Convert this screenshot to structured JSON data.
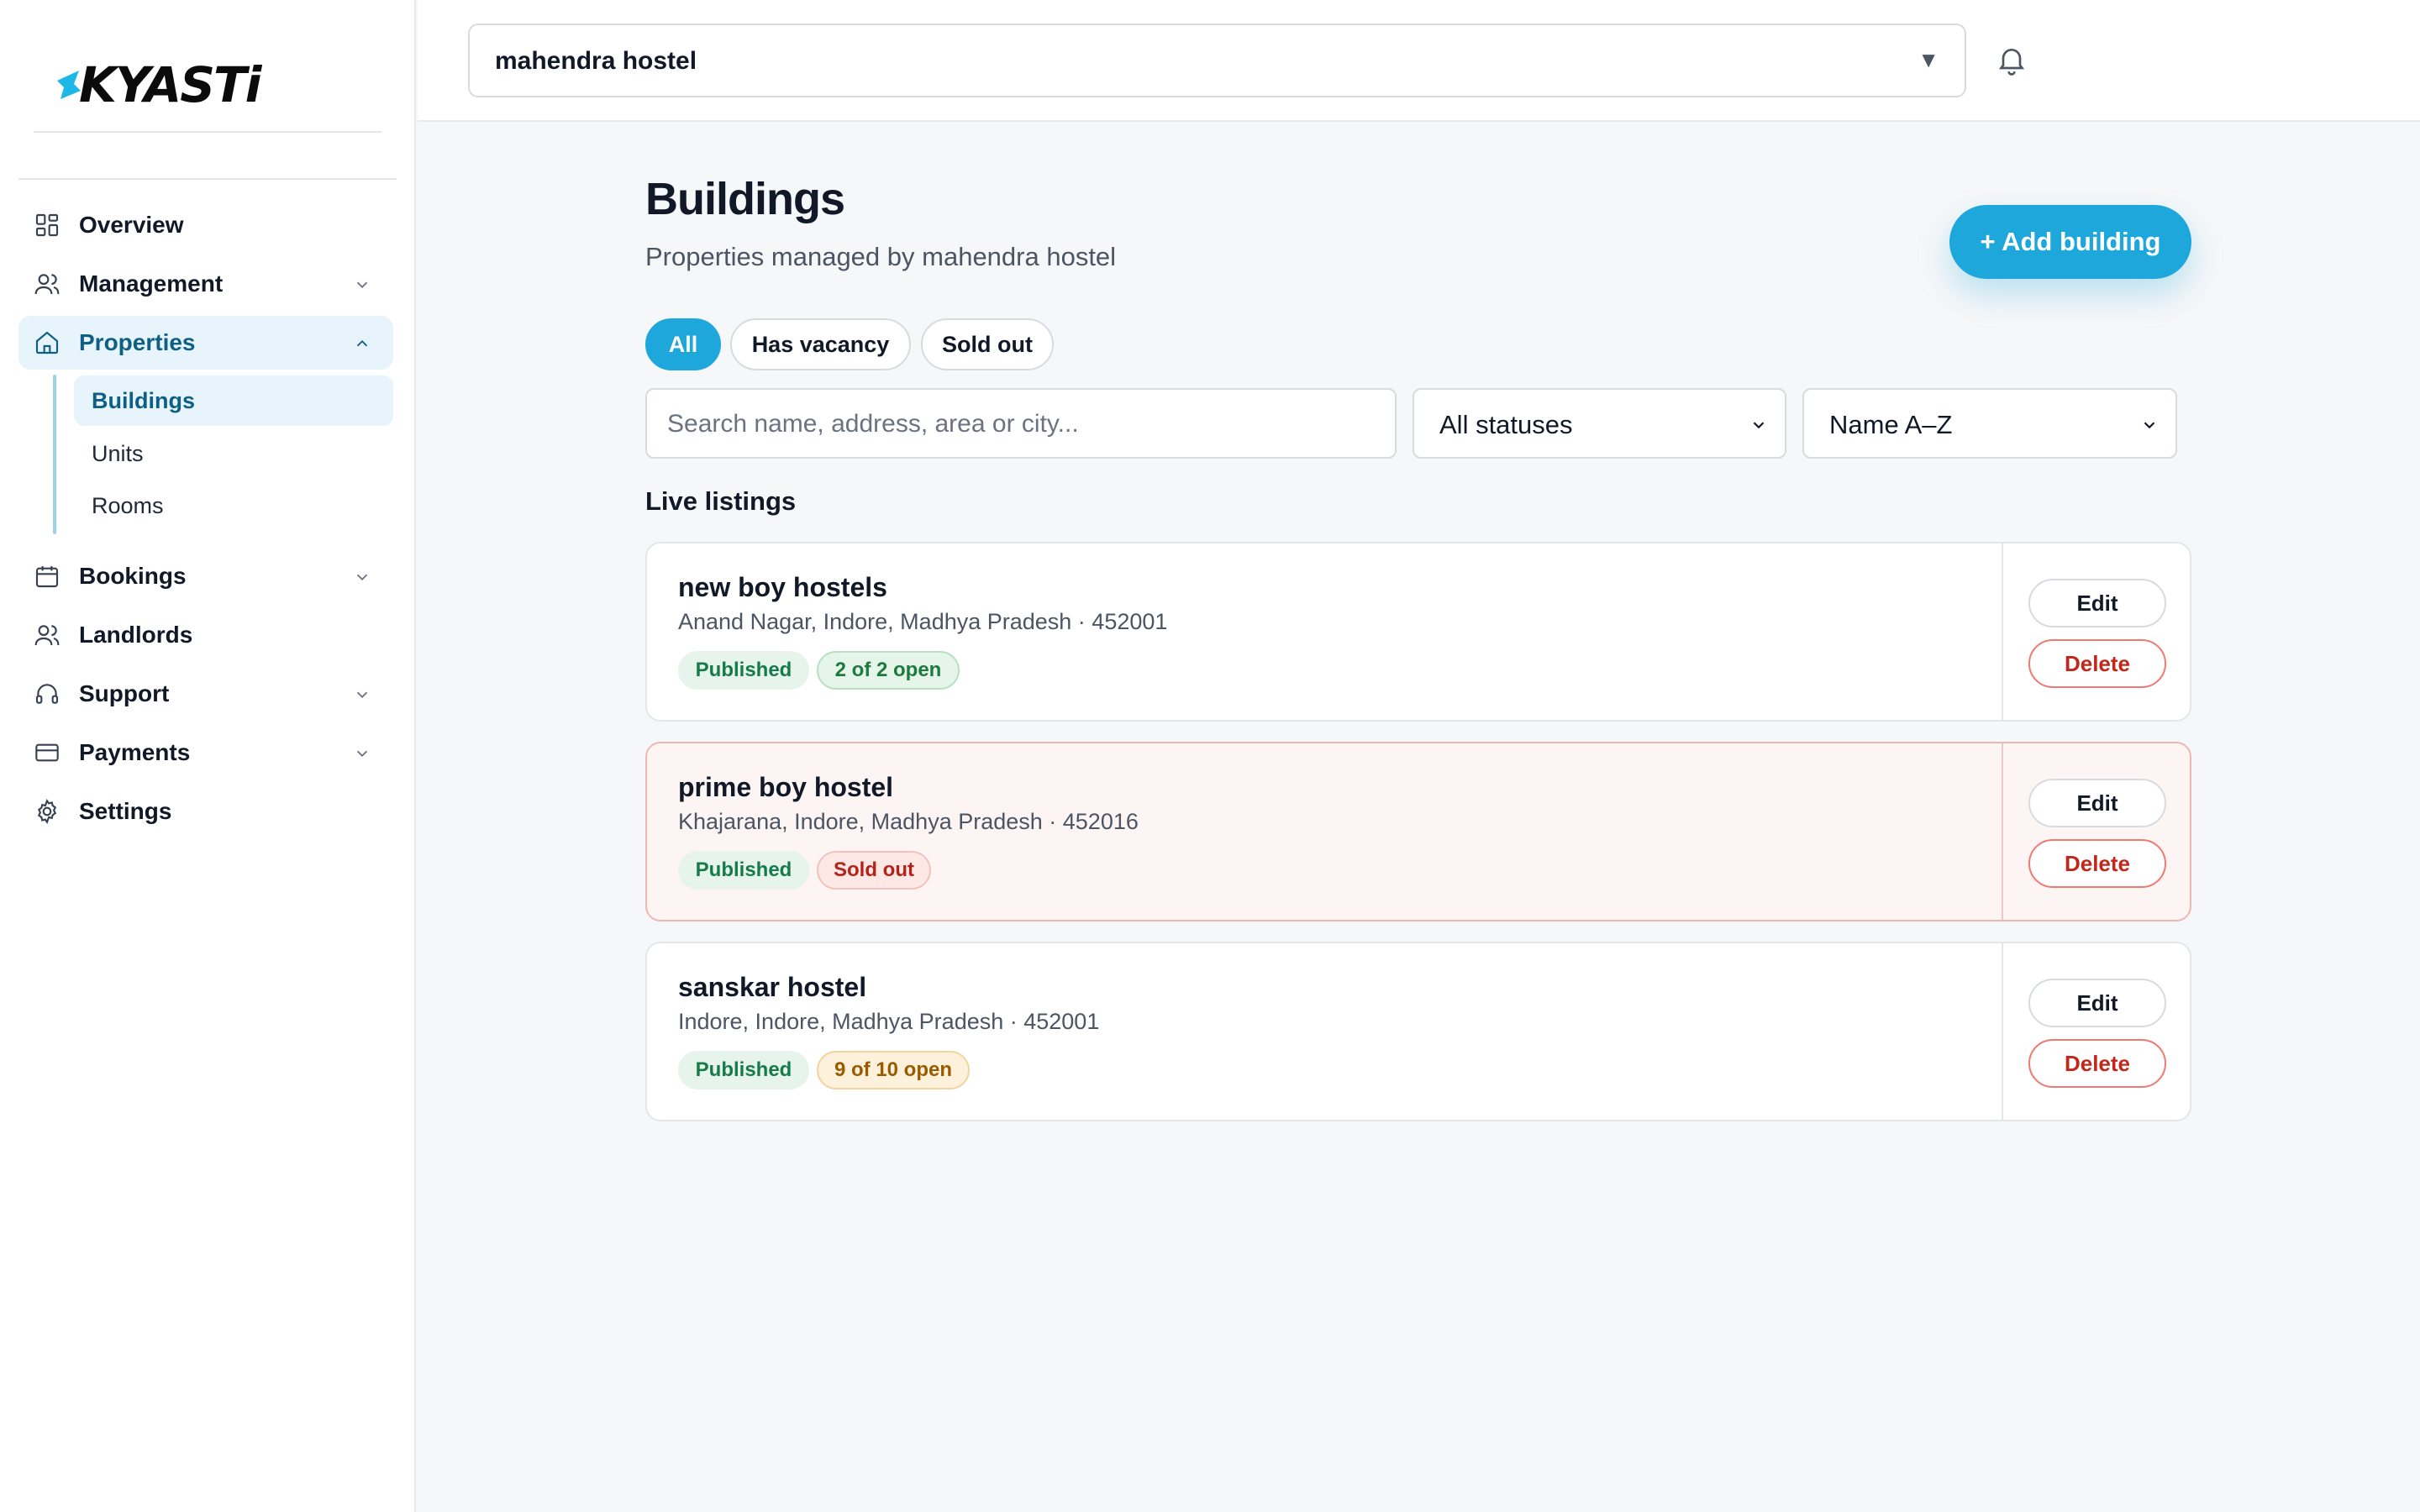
{
  "brand": {
    "logo_text_a": "K",
    "logo_text_b": "YASTi"
  },
  "sidebar": {
    "items": [
      {
        "label": "Overview",
        "icon": "grid-icon"
      },
      {
        "label": "Management",
        "icon": "users-icon"
      },
      {
        "label": "Properties",
        "icon": "home-icon"
      },
      {
        "label": "Bookings",
        "icon": "calendar-icon"
      },
      {
        "label": "Landlords",
        "icon": "users-icon"
      },
      {
        "label": "Support",
        "icon": "headset-icon"
      },
      {
        "label": "Payments",
        "icon": "credit-card-icon"
      },
      {
        "label": "Settings",
        "icon": "gear-icon"
      }
    ],
    "sub_items": [
      {
        "label": "Buildings"
      },
      {
        "label": "Units"
      },
      {
        "label": "Rooms"
      }
    ]
  },
  "topbar": {
    "org_selected": "mahendra hostel",
    "caret": "▼"
  },
  "main": {
    "title": "Buildings",
    "subtitle": "Properties managed by mahendra hostel",
    "add_button": "+ Add building",
    "chips": [
      "All",
      "Has vacancy",
      "Sold out"
    ],
    "search_placeholder": "Search name, address, area or city...",
    "status_filter": "All statuses",
    "sort": "Name A–Z",
    "section_label": "Live listings",
    "edit_label": "Edit",
    "delete_label": "Delete",
    "listings": [
      {
        "name": "new boy hostels",
        "address": "Anand Nagar, Indore, Madhya Pradesh · 452001",
        "status": "Published",
        "availability": "2 of 2 open"
      },
      {
        "name": "prime boy hostel",
        "address": "Khajarana, Indore, Madhya Pradesh · 452016",
        "status": "Published",
        "availability": "Sold out"
      },
      {
        "name": "sanskar hostel",
        "address": "Indore, Indore, Madhya Pradesh · 452001",
        "status": "Published",
        "availability": "9 of 10 open"
      }
    ]
  },
  "colors": {
    "accent": "#1ea7db",
    "active_nav_text": "#0e5f86",
    "published": "#177a4a",
    "sold_out": "#b42318",
    "partial_open": "#9a5a00",
    "delete": "#c2271a"
  }
}
